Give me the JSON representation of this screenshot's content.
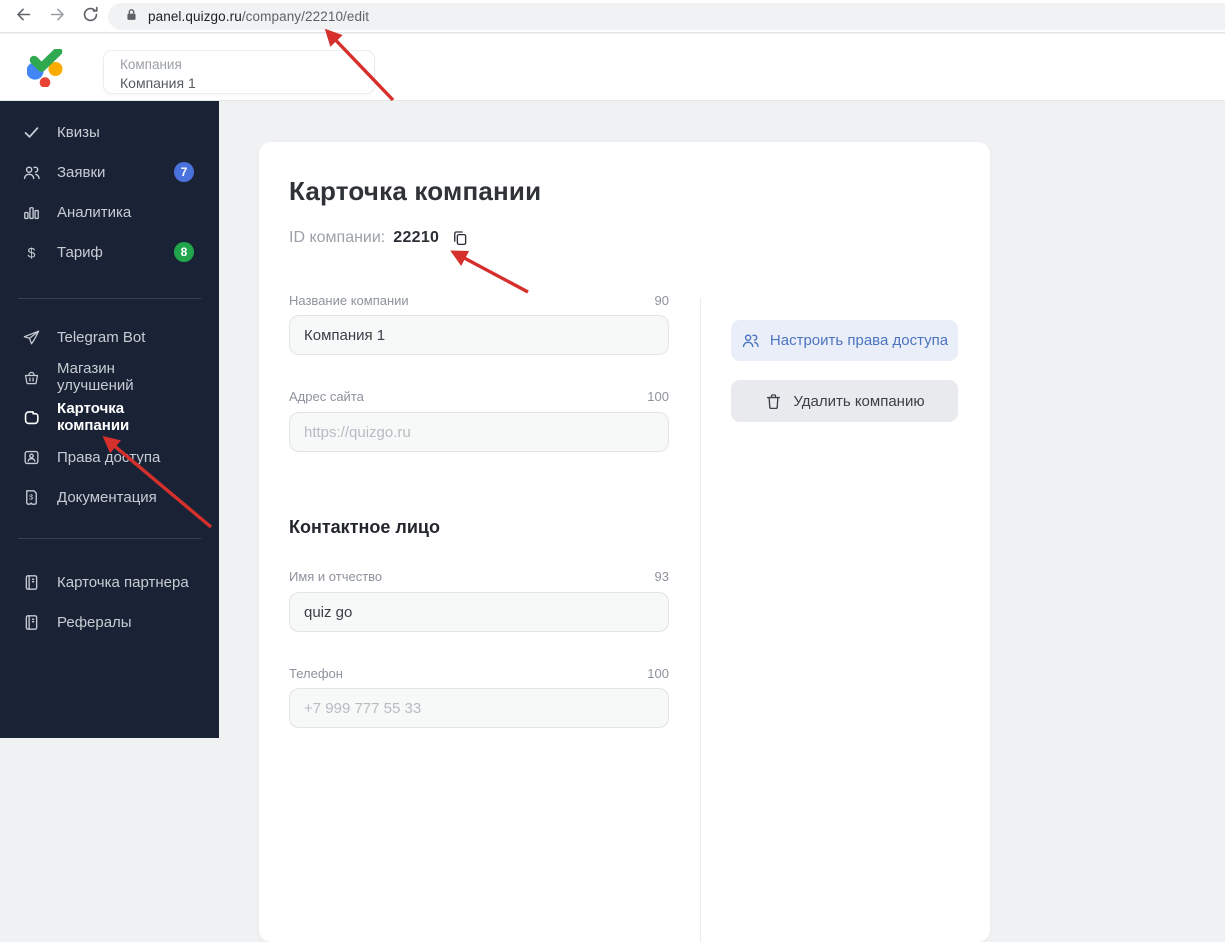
{
  "browser": {
    "url_domain": "panel.quizgo.ru",
    "url_path": "/company/22210/edit"
  },
  "header": {
    "company_selector": {
      "label": "Компания",
      "value": "Компания 1"
    }
  },
  "sidebar": {
    "items": [
      {
        "label": "Квизы",
        "icon": "check-icon"
      },
      {
        "label": "Заявки",
        "icon": "people-icon",
        "badge": "7"
      },
      {
        "label": "Аналитика",
        "icon": "bar-chart-icon"
      },
      {
        "label": "Тариф",
        "icon": "dollar-icon",
        "badge": "8"
      },
      {
        "label": "Telegram Bot",
        "icon": "telegram-icon"
      },
      {
        "label": "Магазин улучшений",
        "icon": "basket-icon"
      },
      {
        "label": "Карточка компании",
        "icon": "company-icon",
        "active": true
      },
      {
        "label": "Права доступа",
        "icon": "id-card-icon"
      },
      {
        "label": "Документация",
        "icon": "bill-icon"
      },
      {
        "label": "Карточка партнера",
        "icon": "journal-icon"
      },
      {
        "label": "Рефералы",
        "icon": "journal-icon"
      }
    ]
  },
  "main": {
    "title": "Карточка компании",
    "id_label": "ID компании:",
    "id_value": "22210",
    "fields": [
      {
        "label": "Название компании",
        "counter": "90",
        "value": "Компания 1"
      },
      {
        "label": "Адрес сайта",
        "counter": "100",
        "placeholder": "https://quizgo.ru"
      }
    ],
    "contact": {
      "title": "Контактное лицо",
      "fields": [
        {
          "label": "Имя и отчество",
          "counter": "93",
          "value": "quiz go"
        },
        {
          "label": "Телефон",
          "counter": "100",
          "placeholder": "+7 999 777 55 33"
        }
      ]
    },
    "actions": [
      {
        "label": "Настроить права доступа"
      },
      {
        "label": "Удалить компанию"
      }
    ]
  },
  "colors": {
    "sidebar_bg": "#1a2336",
    "badge_blue": "#4a72dc",
    "badge_green": "#21a64e",
    "accent_blue": "#4d74be",
    "access_button_bg": "#e9eef9",
    "delete_button_bg": "#e8eaed",
    "annotation_arrow": "#d6302c",
    "logo_green": "#2ea94f",
    "logo_blue": "#4285f4",
    "logo_orange": "#f9ab00",
    "logo_red": "#ea4335"
  }
}
